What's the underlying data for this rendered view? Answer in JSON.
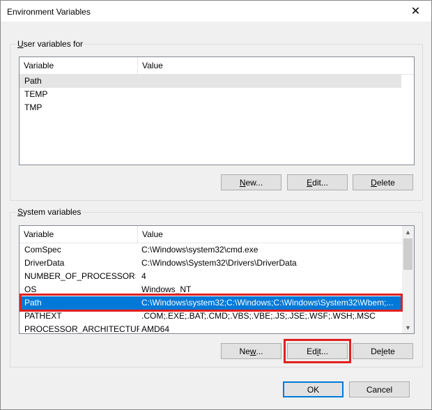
{
  "window": {
    "title": "Environment Variables"
  },
  "user_group": {
    "label": "User variables for",
    "columns": [
      "Variable",
      "Value"
    ],
    "rows": [
      {
        "variable": "Path",
        "value": ""
      },
      {
        "variable": "TEMP",
        "value": ""
      },
      {
        "variable": "TMP",
        "value": ""
      }
    ],
    "buttons": {
      "new": {
        "pre": "",
        "ul": "N",
        "post": "ew..."
      },
      "edit": {
        "pre": "",
        "ul": "E",
        "post": "dit..."
      },
      "delete": {
        "pre": "",
        "ul": "D",
        "post": "elete"
      }
    }
  },
  "system_group": {
    "label_ul": "S",
    "label_rest": "ystem variables",
    "columns": [
      "Variable",
      "Value"
    ],
    "rows": [
      {
        "variable": "ComSpec",
        "value": "C:\\Windows\\system32\\cmd.exe"
      },
      {
        "variable": "DriverData",
        "value": "C:\\Windows\\System32\\Drivers\\DriverData"
      },
      {
        "variable": "NUMBER_OF_PROCESSORS",
        "value": "4"
      },
      {
        "variable": "OS",
        "value": "Windows_NT"
      },
      {
        "variable": "Path",
        "value": "C:\\Windows\\system32;C:\\Windows;C:\\Windows\\System32\\Wbem;..."
      },
      {
        "variable": "PATHEXT",
        "value": ".COM;.EXE;.BAT;.CMD;.VBS;.VBE;.JS;.JSE;.WSF;.WSH;.MSC"
      },
      {
        "variable": "PROCESSOR_ARCHITECTURE",
        "value": "AMD64"
      }
    ],
    "buttons": {
      "new": {
        "pre": "Ne",
        "ul": "w",
        "post": "..."
      },
      "edit": {
        "pre": "Ed",
        "ul": "i",
        "post": "t..."
      },
      "delete": {
        "pre": "De",
        "ul": "l",
        "post": "ete"
      }
    }
  },
  "dialog_buttons": {
    "ok": "OK",
    "cancel": "Cancel"
  },
  "colors": {
    "selection": "#0078d7",
    "highlight_box": "#e02020"
  }
}
